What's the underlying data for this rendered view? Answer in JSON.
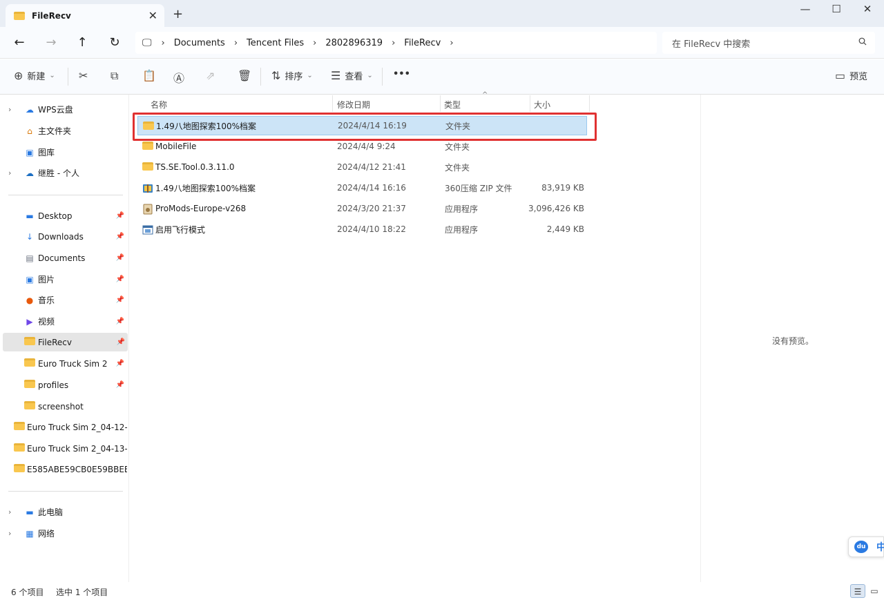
{
  "window": {
    "tab_title": "FileRecv",
    "tab_close": "✕",
    "new_tab": "+",
    "minimize": "—",
    "maximize": "☐",
    "close": "✕"
  },
  "nav": {
    "back": "←",
    "forward": "→",
    "up": "↑",
    "refresh": "↻"
  },
  "address": {
    "computer_icon": "🖵",
    "crumbs": [
      "Documents",
      "Tencent Files",
      "2802896319",
      "FileRecv"
    ],
    "separator": "›"
  },
  "search": {
    "placeholder": "在 FileRecv 中搜索",
    "icon": "search-icon"
  },
  "toolbar": {
    "new_label": "新建",
    "sort_label": "排序",
    "view_label": "查看",
    "more_label": "•••",
    "preview_label": "预览",
    "dropdown_caret": "⌄"
  },
  "sidebar": {
    "top_items": [
      {
        "label": "WPS云盘",
        "icon": "cloud-icon",
        "expandable": true
      },
      {
        "label": "主文件夹",
        "icon": "home-icon",
        "expandable": false
      },
      {
        "label": "图库",
        "icon": "gallery-icon",
        "expandable": false
      },
      {
        "label": "继胜 - 个人",
        "icon": "onedrive-icon",
        "expandable": true
      }
    ],
    "quick_access": [
      {
        "label": "Desktop",
        "icon": "desktop-icon",
        "pinned": true
      },
      {
        "label": "Downloads",
        "icon": "download-icon",
        "pinned": true
      },
      {
        "label": "Documents",
        "icon": "document-icon",
        "pinned": true
      },
      {
        "label": "图片",
        "icon": "pictures-icon",
        "pinned": true
      },
      {
        "label": "音乐",
        "icon": "music-icon",
        "pinned": true
      },
      {
        "label": "视频",
        "icon": "video-icon",
        "pinned": true
      },
      {
        "label": "FileRecv",
        "icon": "folder-icon",
        "pinned": true,
        "selected": true
      },
      {
        "label": "Euro Truck Sim 2",
        "icon": "folder-icon",
        "pinned": true
      },
      {
        "label": "profiles",
        "icon": "folder-icon",
        "pinned": true
      },
      {
        "label": "screenshot",
        "icon": "folder-icon",
        "pinned": false
      },
      {
        "label": "Euro Truck Sim 2_04-12-",
        "icon": "folder-icon",
        "pinned": false
      },
      {
        "label": "Euro Truck Sim 2_04-13-",
        "icon": "folder-icon",
        "pinned": false
      },
      {
        "label": "E585ABE59CB0E59BBEE",
        "icon": "folder-icon",
        "pinned": false
      }
    ],
    "bottom_items": [
      {
        "label": "此电脑",
        "icon": "pc-icon",
        "expandable": true
      },
      {
        "label": "网络",
        "icon": "network-icon",
        "expandable": true
      }
    ]
  },
  "columns": {
    "name": "名称",
    "date": "修改日期",
    "type": "类型",
    "size": "大小",
    "sort_indicator": "^"
  },
  "files": [
    {
      "name": "1.49八地图探索100%档案",
      "date": "2024/4/14 16:19",
      "type": "文件夹",
      "size": "",
      "icon": "folder-icon",
      "selected": true
    },
    {
      "name": "MobileFile",
      "date": "2024/4/4 9:24",
      "type": "文件夹",
      "size": "",
      "icon": "folder-icon"
    },
    {
      "name": "TS.SE.Tool.0.3.11.0",
      "date": "2024/4/12 21:41",
      "type": "文件夹",
      "size": "",
      "icon": "folder-icon"
    },
    {
      "name": "1.49八地图探索100%档案",
      "date": "2024/4/14 16:16",
      "type": "360压缩 ZIP 文件",
      "size": "83,919 KB",
      "icon": "zip-icon"
    },
    {
      "name": "ProMods-Europe-v268",
      "date": "2024/3/20 21:37",
      "type": "应用程序",
      "size": "3,096,426 KB",
      "icon": "installer-icon"
    },
    {
      "name": "启用飞行模式",
      "date": "2024/4/10 18:22",
      "type": "应用程序",
      "size": "2,449 KB",
      "icon": "app-icon"
    }
  ],
  "preview": {
    "empty_text": "没有预览。"
  },
  "status": {
    "item_count": "6 个项目",
    "selected_count": "选中 1 个项目"
  },
  "ime": {
    "badge": "du",
    "lang": "中"
  },
  "colors": {
    "accent": "#0067c0",
    "selection": "#cce4f7",
    "highlight_box": "#e03131",
    "folder": "#f9c74f"
  }
}
